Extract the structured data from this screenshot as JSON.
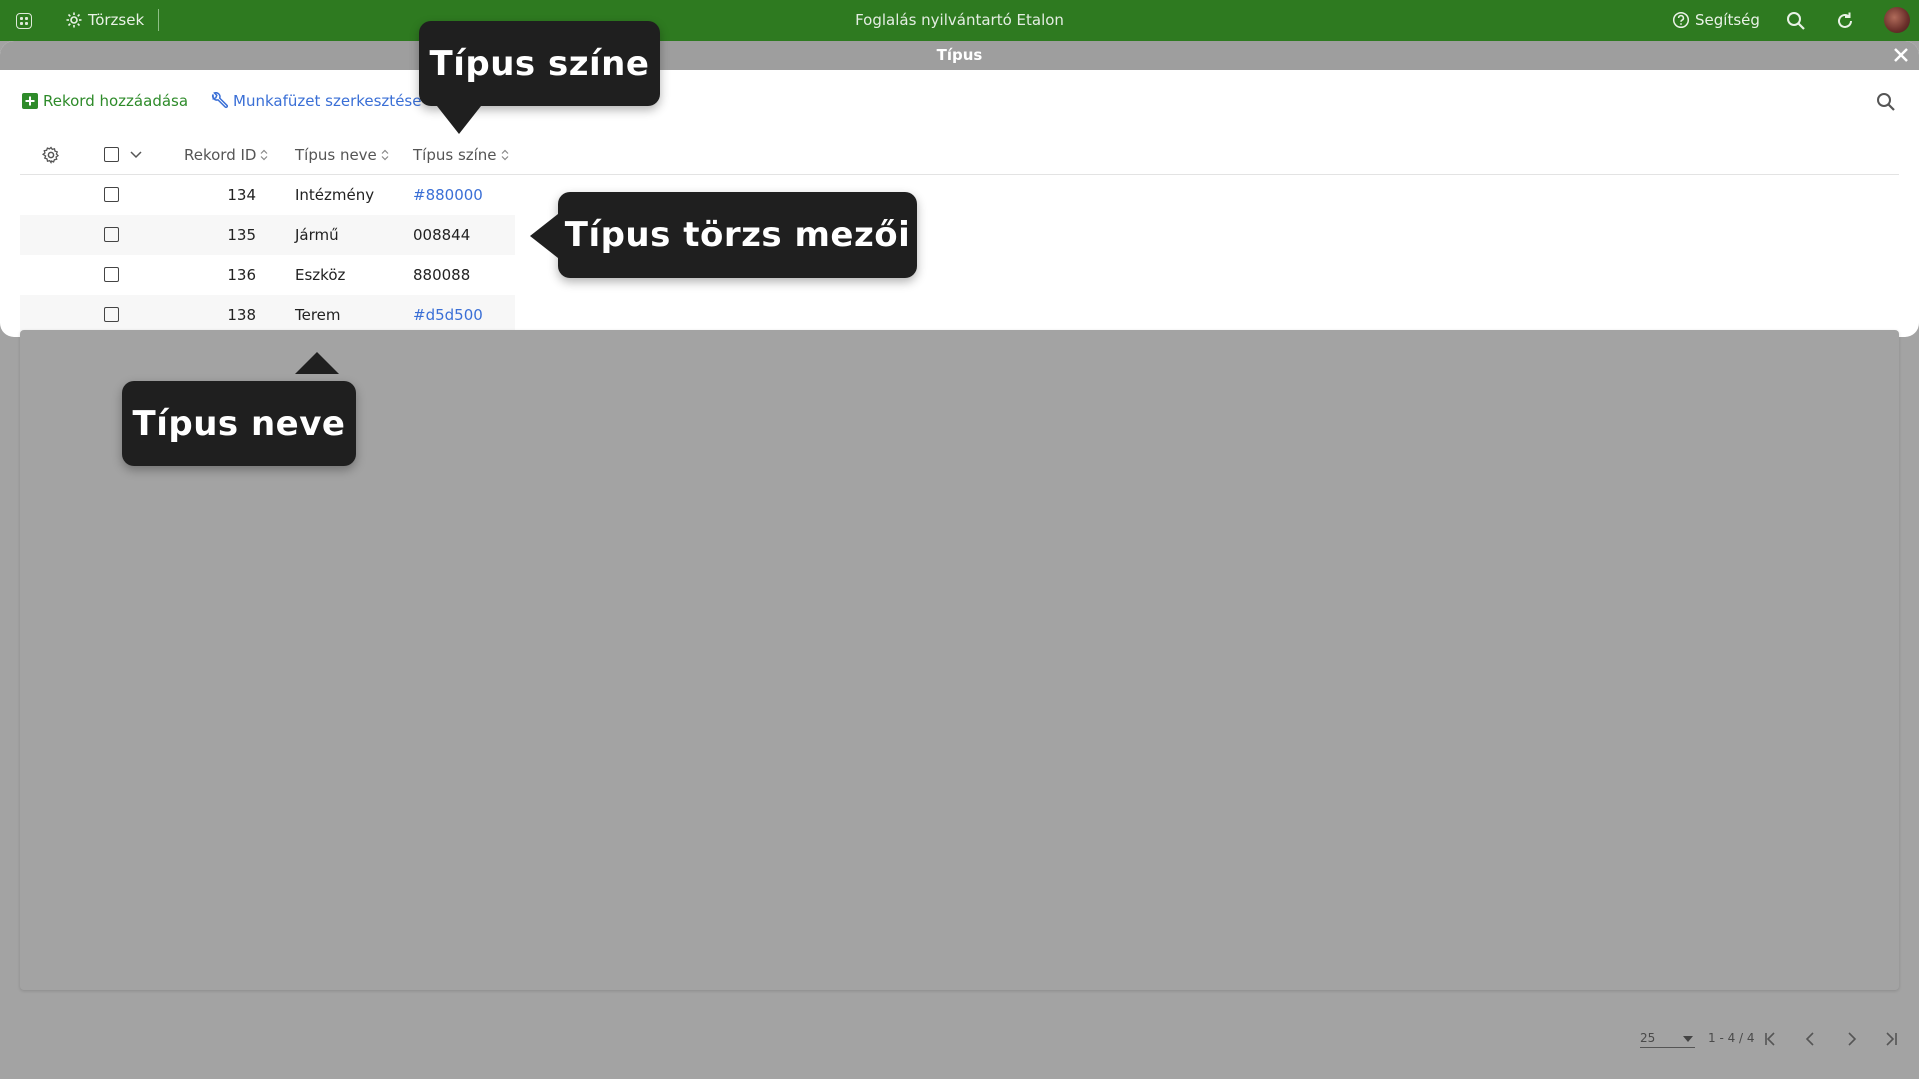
{
  "topbar": {
    "section_label": "Törzsek",
    "app_title": "Foglalás nyilvántartó Etalon",
    "help_label": "Segítség"
  },
  "modal": {
    "title": "Típus",
    "toolbar": {
      "add_record": "Rekord hozzáadása",
      "edit_workbook": "Munkafüzet szerkesztése"
    },
    "grid": {
      "columns": [
        "Rekord ID",
        "Típus neve",
        "Típus színe"
      ],
      "rows": [
        {
          "id": "134",
          "name": "Intézmény",
          "color": "#880000",
          "color_is_link": true
        },
        {
          "id": "135",
          "name": "Jármű",
          "color": "008844",
          "color_is_link": false
        },
        {
          "id": "136",
          "name": "Eszköz",
          "color": "880088",
          "color_is_link": false
        },
        {
          "id": "138",
          "name": "Terem",
          "color": "#d5d500",
          "color_is_link": true
        }
      ]
    }
  },
  "pager": {
    "page_size": "25",
    "range": "1 - 4 / 4"
  },
  "callouts": {
    "color_field": "Típus színe",
    "fields": "Típus törzs mezői",
    "name_field": "Típus neve"
  },
  "colors": {
    "topbar": "#2e7a20",
    "add_green": "#2e8b2a",
    "link_blue": "#3a6fd6",
    "overlay": "#a3a3a3"
  }
}
